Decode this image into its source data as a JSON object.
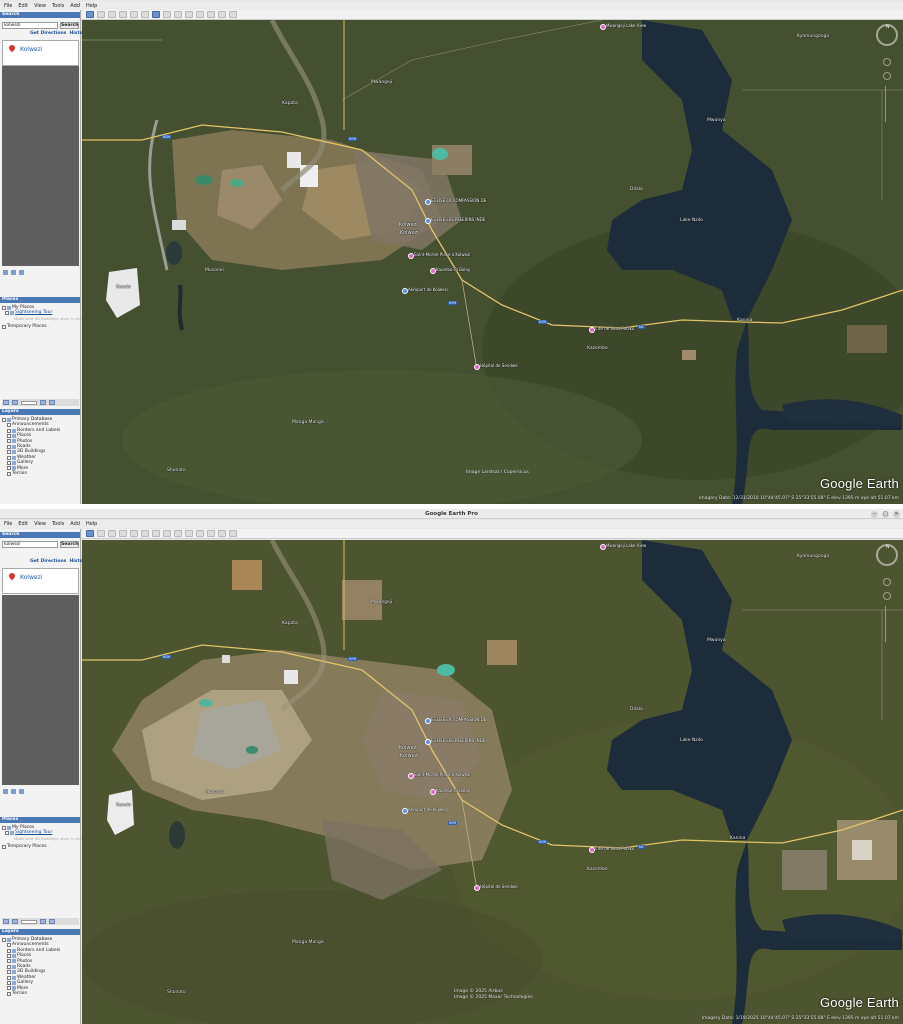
{
  "menu": [
    "File",
    "Edit",
    "View",
    "Tools",
    "Add",
    "Help"
  ],
  "top": {
    "window_title": "",
    "search_header": "Search",
    "search_value": "kolwezi",
    "search_button": "Search",
    "get_directions": "Get Directions",
    "history": "History",
    "result_name": "Kolwezi",
    "places_header": "Places",
    "layers_header": "Layers",
    "places_tree": [
      "My Places",
      "Sightseeing Tour",
      "Temporary Places"
    ],
    "sightseeing_hint": "Make sure 3D Buildings layer is checked",
    "layers_tree": [
      "Primary Database",
      "Announcements",
      "Borders and Labels",
      "Places",
      "Photos",
      "Roads",
      "3D Buildings",
      "Weather",
      "Gallery",
      "More",
      "Terrain"
    ],
    "status": "Imagery Date: 12/31/2010    10°44'45.07\" S   25°33'55.08\" E  elev  1395 m    eye alt  51.07 km",
    "attribution": [
      "Image Landsat / Copernicus"
    ],
    "brand": "Google Earth"
  },
  "bottom": {
    "window_title": "Google Earth Pro",
    "search_header": "Search",
    "search_value": "kolwezi",
    "search_button": "Search",
    "get_directions": "Get Directions",
    "history": "History",
    "result_name": "Kolwezi",
    "places_header": "Places",
    "layers_header": "Layers",
    "places_tree": [
      "My Places",
      "Sightseeing Tour",
      "Temporary Places"
    ],
    "sightseeing_hint": "Make sure 3D Buildings layer is checked",
    "layers_tree": [
      "Primary Database",
      "Announcements",
      "Borders and Labels",
      "Places",
      "Photos",
      "Roads",
      "3D Buildings",
      "Weather",
      "Gallery",
      "More",
      "Terrain"
    ],
    "status": "Imagery Date: 1/19/2025    10°44'45.07\" S   25°33'55.08\" E  elev  1395 m    eye alt  51.07 km",
    "attribution": [
      "Image © 2025 Airbus",
      "Image © 2025 Maxar Technologies"
    ],
    "brand": "Google Earth"
  },
  "map_labels": {
    "mwangeji": "Mwangeji",
    "kolwezi": "Kolwezi",
    "kolwezi_city": "Kolwezi",
    "lake_nzilo": "Lake Nzilo",
    "manga_manga": "Manga Manga",
    "shonoto": "Shonoto",
    "kazembe": "Kazembe",
    "kyamungongo": "Kyamungongo",
    "dilala": "Dilala",
    "mwanya": "Mwanya",
    "musonoi": "Musonoi",
    "kapata": "Kapata",
    "kanina": "Kanina",
    "kasulo": "Kasulo"
  },
  "poi_labels": {
    "lake_view": "Mwangeji Lake View",
    "eglise_compassion": "EGLISE LA COMPASSION DE",
    "eglise_pelerins": "EGLISE LES PELERINS INDE",
    "saint_michel": "Saint-Michel Place à Kolwezi",
    "kaumbo": "Kaumbo-Ta Bolay",
    "aeroport": "Aéroport de Kolwezi",
    "hopital": "Hôpital de Sendwe",
    "dilala_poi": "Dilala",
    "sasa_pelaku": "Cité de Sasa Pelaku"
  },
  "road_shields": [
    "N39",
    "N39",
    "N39",
    "N39",
    "N1"
  ]
}
